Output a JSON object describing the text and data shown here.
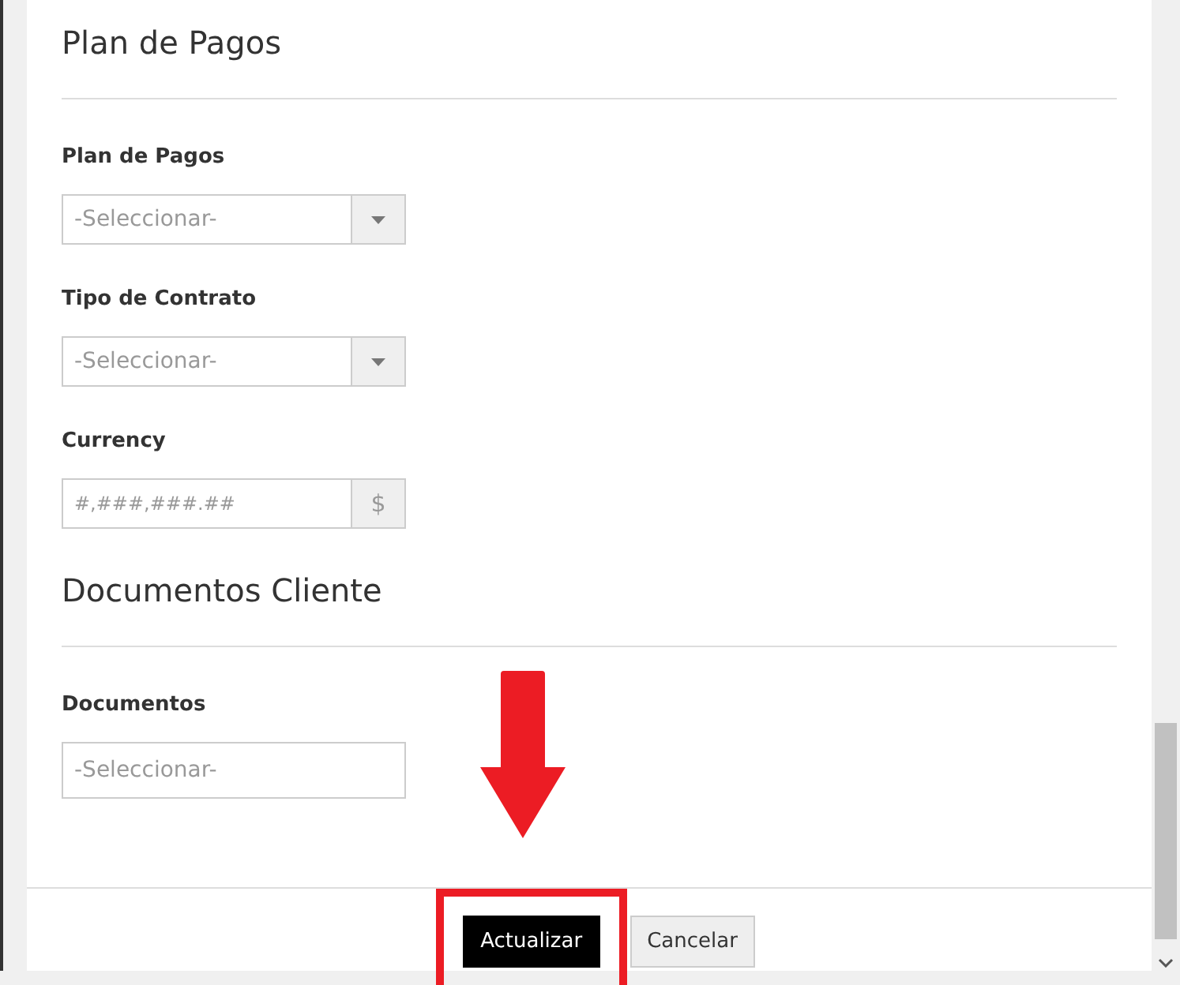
{
  "sections": [
    {
      "title": "Plan de Pagos",
      "fields": [
        {
          "label": "Plan de Pagos",
          "kind": "select",
          "placeholder": "-Seleccionar-"
        },
        {
          "label": "Tipo de Contrato",
          "kind": "select",
          "placeholder": "-Seleccionar-"
        },
        {
          "label": "Currency",
          "kind": "currency",
          "placeholder": "#,###,###.##",
          "addon": "$"
        }
      ]
    },
    {
      "title": "Documentos Cliente",
      "fields": [
        {
          "label": "Documentos",
          "kind": "multiselect",
          "placeholder": "-Seleccionar-"
        }
      ]
    }
  ],
  "buttons": [
    {
      "label": "Actualizar",
      "kind": "primary",
      "highlighted": true
    },
    {
      "label": "Cancelar",
      "kind": "secondary",
      "highlighted": false
    }
  ]
}
